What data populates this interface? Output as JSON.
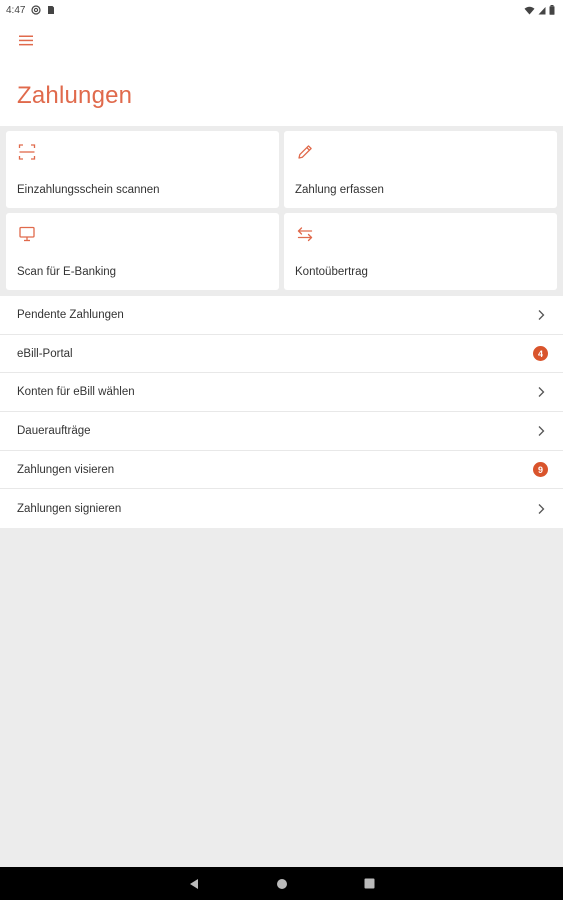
{
  "status_bar": {
    "time": "4:47",
    "icons": [
      "at-sign-icon",
      "sim-card-icon",
      "wifi-icon",
      "signal-icon",
      "battery-icon"
    ]
  },
  "header": {
    "menu_icon": "hamburger-menu-icon",
    "title": "Zahlungen"
  },
  "tiles": [
    {
      "label": "Einzahlungsschein scannen",
      "icon": "scan-frame-icon"
    },
    {
      "label": "Zahlung erfassen",
      "icon": "pencil-icon"
    },
    {
      "label": "Scan für E-Banking",
      "icon": "monitor-icon"
    },
    {
      "label": "Kontoübertrag",
      "icon": "transfer-arrows-icon"
    }
  ],
  "list": [
    {
      "label": "Pendente Zahlungen",
      "badge": null
    },
    {
      "label": "eBill-Portal",
      "badge": "4"
    },
    {
      "label": "Konten für eBill wählen",
      "badge": null
    },
    {
      "label": "Daueraufträge",
      "badge": null
    },
    {
      "label": "Zahlungen visieren",
      "badge": "9"
    },
    {
      "label": "Zahlungen signieren",
      "badge": null
    }
  ],
  "colors": {
    "accent": "#e06a4c",
    "badge": "#d9542c",
    "background": "#ececec"
  },
  "nav_bar": [
    "back-icon",
    "home-icon",
    "recents-icon"
  ]
}
